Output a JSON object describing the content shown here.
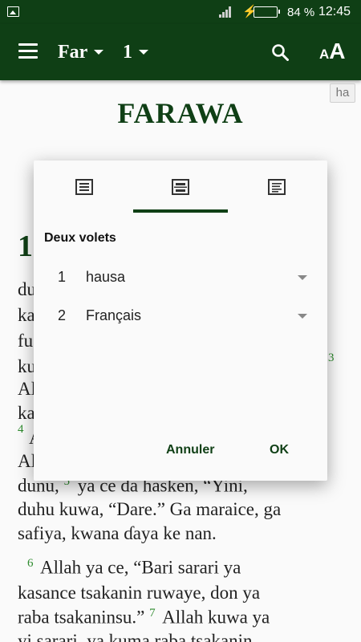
{
  "status_bar": {
    "battery_percent": "84 %",
    "battery_level": 0.84,
    "time": "12:45",
    "icons": [
      "gallery-icon",
      "signal-icon",
      "charging-bolt-icon",
      "battery-icon"
    ]
  },
  "app_bar": {
    "book": "Far",
    "chapter": "1",
    "icons": [
      "menu-icon",
      "search-icon",
      "text-size-icon"
    ],
    "text_size_label_small": "A",
    "text_size_label_big": "A"
  },
  "content": {
    "language_badge": "ha",
    "title": "FARAWA",
    "chapter_number": "1",
    "lines": [
      "du",
      "ka",
      "fu",
      "ku",
      "Al",
      "ka",
      "A",
      "Al",
      "dunu,",
      "duhu kuwa, “Dare.” Ga maraice, ga",
      "safiya, kwana ɗaya ke nan.",
      "Allah ya ce, “Bari sarari ya",
      "kasance tsakanin ruwaye, don ya",
      "raba tsakaninsu.”",
      "Allah kuwa ya",
      "yi sarari, ya kuma raba tsakanin"
    ],
    "line8_rest": "ya ce da hasken, “Yini,",
    "verse_numbers": {
      "v3": "3",
      "v4": "4",
      "v5": "5",
      "v6": "6",
      "v7": "7"
    }
  },
  "dialog": {
    "tabs": [
      {
        "name": "single-pane",
        "icon": "single-pane-icon",
        "selected": false
      },
      {
        "name": "two-panes",
        "icon": "two-panes-icon",
        "selected": true
      },
      {
        "name": "interlinear",
        "icon": "interlinear-icon",
        "selected": false
      }
    ],
    "title": "Deux volets",
    "panes": [
      {
        "number": "1",
        "value": "hausa"
      },
      {
        "number": "2",
        "value": "Français"
      }
    ],
    "cancel_label": "Annuler",
    "ok_label": "OK"
  },
  "colors": {
    "primary": "#0f3f15",
    "verse_number": "#2e8b2e",
    "battery_fill": "#4cd964"
  }
}
